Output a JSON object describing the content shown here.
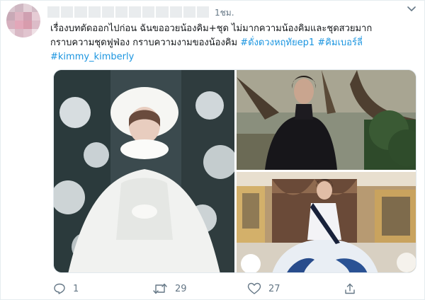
{
  "tweet": {
    "timestamp": "1ชม.",
    "text_lines": [
      "เรื่องบทตัดออกไปก่อน ฉันขออวยน้องคิม+ชุด ไม่มากความน้องคิมและชุดสวยมาก",
      "กราบความชุดฟูฟ่อง กราบความงามของน้องคิม"
    ],
    "hashtags": [
      "#ดั่งดวงหฤทัยep1",
      "#คิมเบอร์ลี่",
      "#kimmy_kimberly"
    ]
  },
  "actions": {
    "reply_count": "1",
    "retweet_count": "29",
    "like_count": "27"
  },
  "icons": {
    "reply": "reply-icon",
    "retweet": "retweet-icon",
    "like": "heart-icon",
    "share": "share-icon",
    "menu": "chevron-down-icon"
  },
  "colors": {
    "hashtag": "#1b95e0",
    "secondary_text": "#657786",
    "primary_text": "#14171a"
  }
}
